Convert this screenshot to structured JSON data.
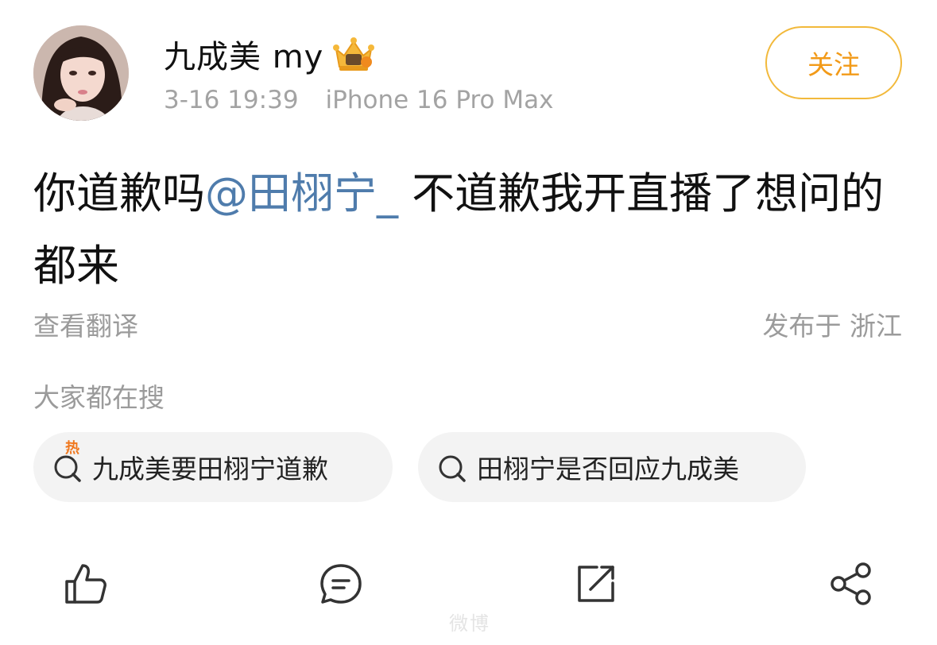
{
  "post": {
    "author": "九成美 my",
    "date": "3-16 19:39",
    "device": "iPhone 16 Pro Max",
    "follow_label": "关注",
    "text_part1": "你道歉吗",
    "mention": "@田栩宁_",
    "text_part2": " 不道歉我开直播了想问的都来",
    "translate_label": "查看翻译",
    "location": "发布于 浙江"
  },
  "search": {
    "heading": "大家都在搜",
    "hot_badge": "热",
    "chips": [
      {
        "label": "九成美要田栩宁道歉",
        "icon": "hot-search-icon"
      },
      {
        "label": "田栩宁是否回应九成美",
        "icon": "search-icon"
      }
    ]
  },
  "actions": [
    {
      "icon": "like-icon"
    },
    {
      "icon": "comment-icon"
    },
    {
      "icon": "repost-icon"
    },
    {
      "icon": "share-icon"
    }
  ],
  "watermark": "微博",
  "colors": {
    "accent_orange": "#f29a18",
    "follow_border": "#f2b93b",
    "mention_blue": "#4f7cac",
    "meta_gray": "#a3a3a3",
    "chip_bg": "#f3f3f3"
  }
}
